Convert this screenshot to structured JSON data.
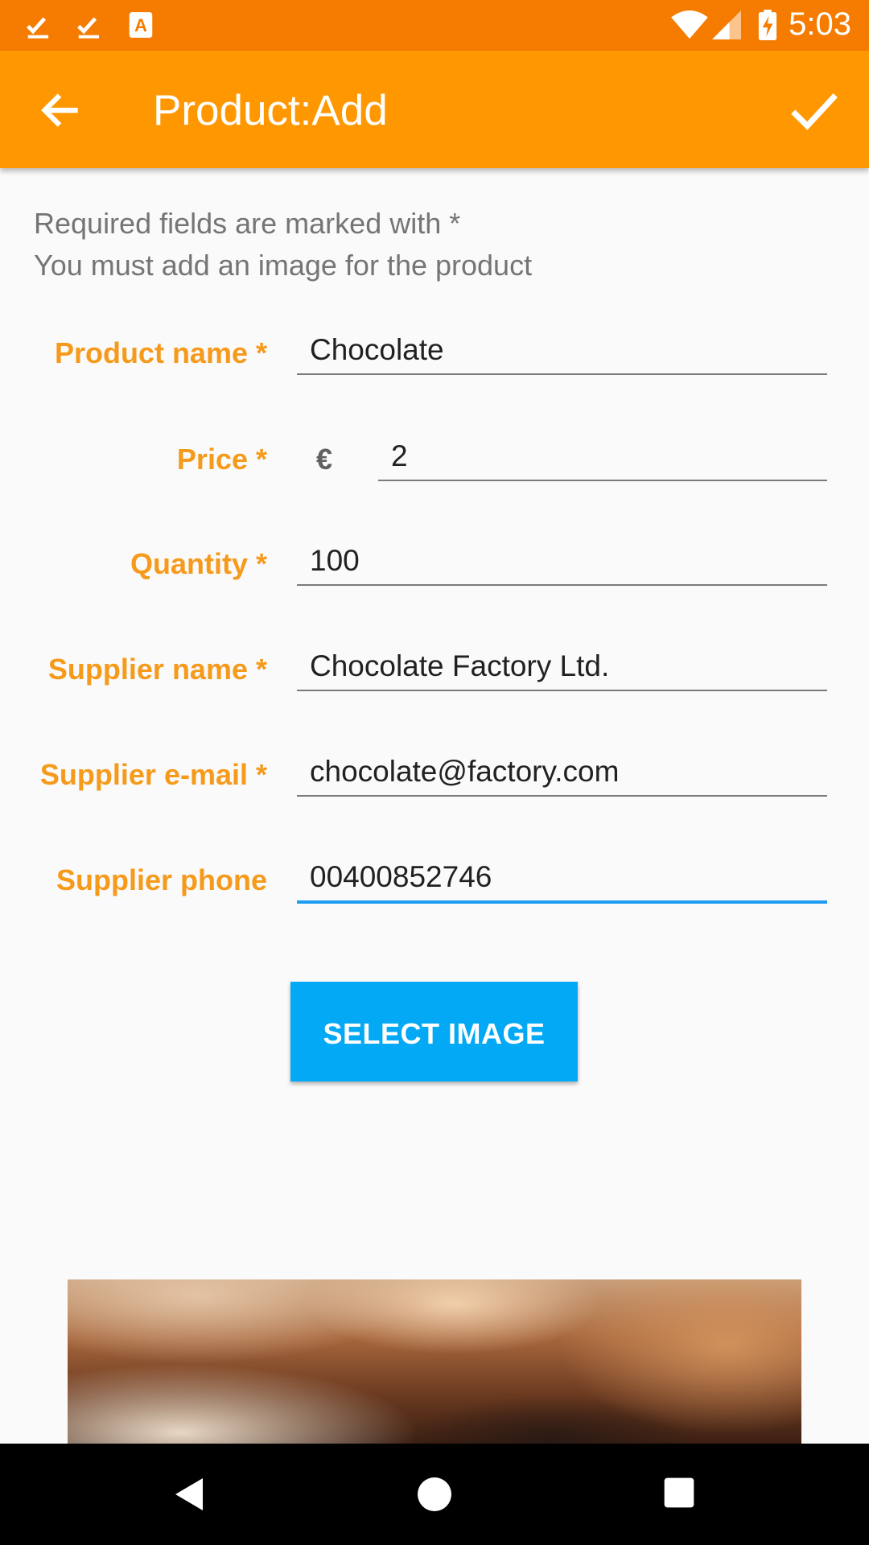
{
  "status_bar": {
    "time": "5:03",
    "icons": [
      "download-done-icon",
      "download-done-icon",
      "text-app-icon",
      "wifi-icon",
      "signal-icon",
      "battery-charging-icon"
    ]
  },
  "app_bar": {
    "title": "Product:Add",
    "back_icon": "arrow-back-icon",
    "done_icon": "check-icon"
  },
  "info": {
    "line1": "Required fields are marked with *",
    "line2": "You must add an image for the product"
  },
  "form": {
    "product_name": {
      "label": "Product name *",
      "value": "Chocolate"
    },
    "price": {
      "label": "Price *",
      "currency": "€",
      "value": "2"
    },
    "quantity": {
      "label": "Quantity *",
      "value": "100"
    },
    "supplier_name": {
      "label": "Supplier name *",
      "value": "Chocolate Factory Ltd."
    },
    "supplier_email": {
      "label": "Supplier e-mail *",
      "value": "chocolate@factory.com"
    },
    "supplier_phone": {
      "label": "Supplier phone",
      "value": "00400852746"
    }
  },
  "select_image_button": {
    "label": "SELECT IMAGE"
  },
  "colors": {
    "status_bar": "#f57c00",
    "app_bar": "#ff9800",
    "label": "#f59a1b",
    "button": "#03a9f4",
    "focused_underline": "#1e9cf0"
  },
  "nav_bar": {
    "icons": [
      "back-triangle-icon",
      "home-circle-icon",
      "recents-square-icon"
    ]
  }
}
